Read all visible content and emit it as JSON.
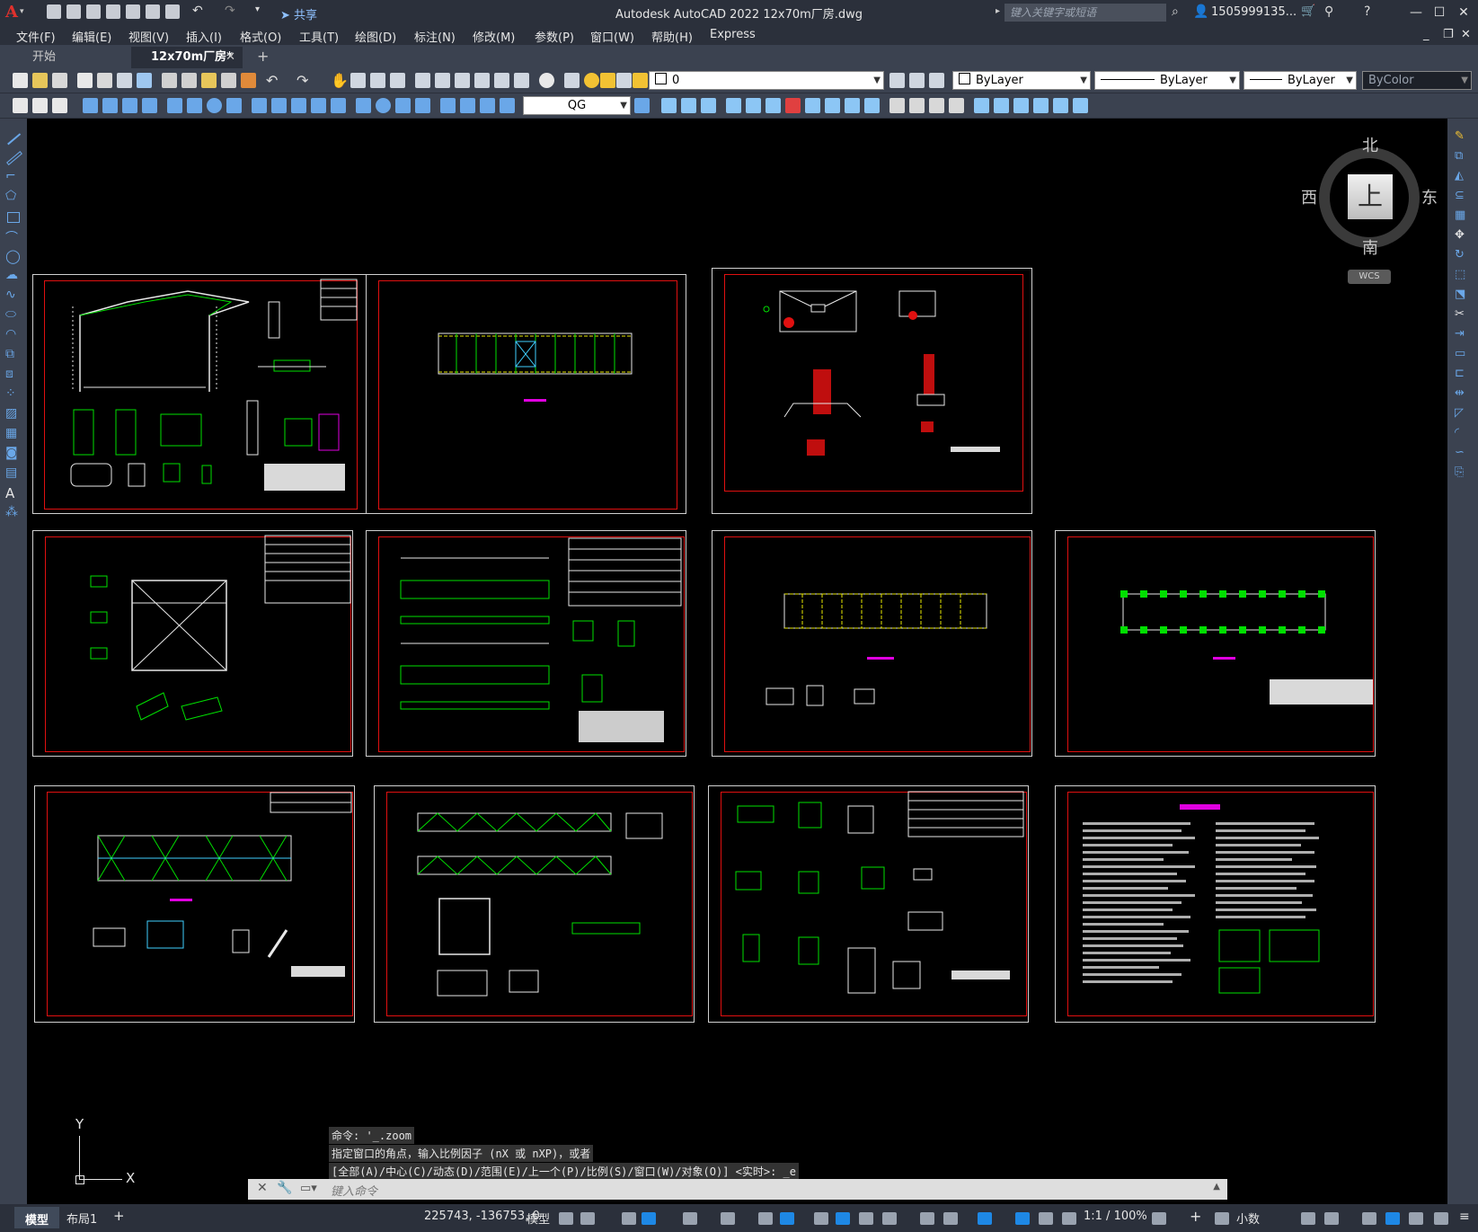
{
  "app": {
    "title": "Autodesk AutoCAD 2022    12x70m厂房.dwg",
    "logo": "A",
    "share_label": "共享",
    "search_placeholder": "键入关键字或短语",
    "user_name": "1505999135...",
    "window_controls": [
      "—",
      "☐",
      "✕"
    ]
  },
  "menu": [
    "文件(F)",
    "编辑(E)",
    "视图(V)",
    "插入(I)",
    "格式(O)",
    "工具(T)",
    "绘图(D)",
    "标注(N)",
    "修改(M)",
    "参数(P)",
    "窗口(W)",
    "帮助(H)",
    "Express"
  ],
  "tabs": [
    {
      "label": "开始"
    },
    {
      "label": "12x70m厂房*",
      "close": "✕"
    }
  ],
  "tab_add": "+",
  "toolbar": {
    "layer_value": "0",
    "color_value": "ByLayer",
    "linetype_value": "ByLayer",
    "lineweight_value": "ByLayer",
    "plotstyle_value": "ByColor",
    "textstyle_value": "QG"
  },
  "viewcube": {
    "north": "北",
    "south": "南",
    "east": "东",
    "west": "西",
    "top": "上",
    "wcs": "WCS"
  },
  "ucs": {
    "y": "Y",
    "x": "X"
  },
  "command": {
    "history": [
      "命令: '_.zoom",
      "指定窗口的角点，输入比例因子 (nX 或 nXP)，或者",
      "[全部(A)/中心(C)/动态(D)/范围(E)/上一个(P)/比例(S)/窗口(W)/对象(O)] <实时>: _e"
    ],
    "placeholder": "键入命令"
  },
  "status": {
    "layout_tabs": [
      "模型",
      "布局1"
    ],
    "add": "+",
    "coordinates": "225743, -136753, 0",
    "model_label": "模型",
    "scale": "1:1 / 100%",
    "units": "小数"
  },
  "colors": {
    "accent": "#1e88e5",
    "sheet_frame": "#e01010",
    "green": "#00e000",
    "yellow": "#e8e800",
    "magenta": "#e000e0"
  }
}
